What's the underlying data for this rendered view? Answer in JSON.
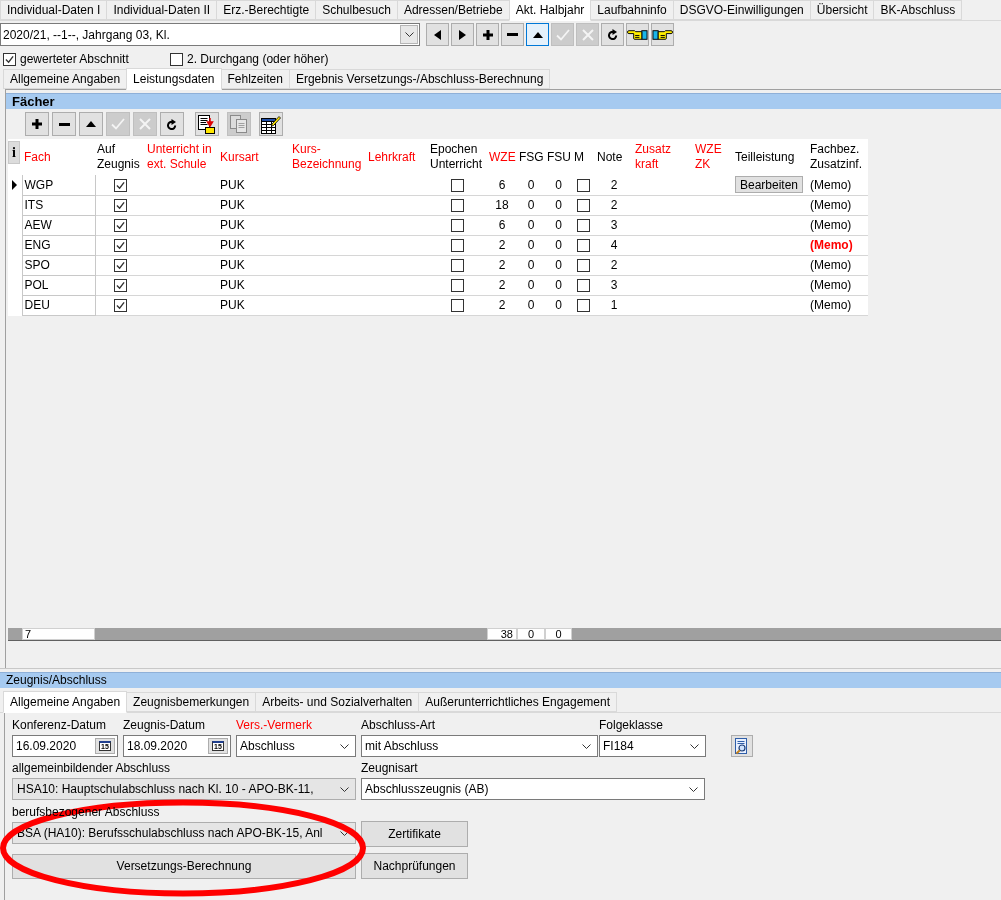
{
  "main_tabs": [
    {
      "label": "Individual-Daten I",
      "selected": false
    },
    {
      "label": "Individual-Daten II",
      "selected": false
    },
    {
      "label": "Erz.-Berechtigte",
      "selected": false
    },
    {
      "label": "Schulbesuch",
      "selected": false
    },
    {
      "label": "Adressen/Betriebe",
      "selected": false
    },
    {
      "label": "Akt. Halbjahr",
      "selected": true
    },
    {
      "label": "Laufbahninfo",
      "selected": false
    },
    {
      "label": "DSGVO-Einwilligungen",
      "selected": false
    },
    {
      "label": "Übersicht",
      "selected": false
    },
    {
      "label": "BK-Abschluss",
      "selected": false
    }
  ],
  "section_select": {
    "value": "2020/21, --1--, Jahrgang 03, Kl."
  },
  "nav_toolbar": [
    {
      "kind": "prev",
      "disabled": false,
      "focused": false
    },
    {
      "kind": "next",
      "disabled": false,
      "focused": false
    },
    {
      "kind": "add",
      "disabled": false,
      "focused": false
    },
    {
      "kind": "remove",
      "disabled": false,
      "focused": false
    },
    {
      "kind": "up",
      "disabled": false,
      "focused": true
    },
    {
      "kind": "confirm",
      "disabled": true,
      "focused": false
    },
    {
      "kind": "cancel",
      "disabled": true,
      "focused": false
    },
    {
      "kind": "refresh",
      "disabled": false,
      "focused": false
    },
    {
      "kind": "hand_left",
      "disabled": false,
      "focused": false
    },
    {
      "kind": "hand_right",
      "disabled": false,
      "focused": false
    }
  ],
  "options": [
    {
      "label": "gewerteter Abschnitt",
      "checked": true
    },
    {
      "label": "2. Durchgang (oder höher)",
      "checked": false
    }
  ],
  "sub_tabs": [
    {
      "label": "Allgemeine Angaben",
      "selected": false
    },
    {
      "label": "Leistungsdaten",
      "selected": true
    },
    {
      "label": "Fehlzeiten",
      "selected": false
    },
    {
      "label": "Ergebnis Versetzungs-/Abschluss-Berechnung",
      "selected": false
    }
  ],
  "faecher": {
    "title": "Fächer",
    "toolbar": [
      {
        "kind": "add",
        "disabled": false
      },
      {
        "kind": "remove",
        "disabled": false
      },
      {
        "kind": "up",
        "disabled": false
      },
      {
        "kind": "confirm",
        "disabled": true
      },
      {
        "kind": "cancel",
        "disabled": true
      },
      {
        "kind": "refresh",
        "disabled": false
      },
      {
        "kind": "import",
        "disabled": false
      },
      {
        "kind": "copy",
        "disabled": true
      },
      {
        "kind": "edit_table",
        "disabled": false
      }
    ],
    "info_button": "i",
    "columns": [
      {
        "label": "Fach",
        "color": "#ff0000"
      },
      {
        "label": "Auf Zeugnis",
        "color": "#000000"
      },
      {
        "label": "Unterricht in ext. Schule",
        "color": "#ff0000"
      },
      {
        "label": "Kursart",
        "color": "#ff0000"
      },
      {
        "label": "Kurs-Bezeichnung",
        "color": "#ff0000"
      },
      {
        "label": "Lehrkraft",
        "color": "#ff0000"
      },
      {
        "label": "Epochen Unterricht",
        "color": "#000000"
      },
      {
        "label": "WZE",
        "color": "#ff0000"
      },
      {
        "label": "FSG",
        "color": "#000000"
      },
      {
        "label": "FSU",
        "color": "#000000"
      },
      {
        "label": "M",
        "color": "#000000"
      },
      {
        "label": "Note",
        "color": "#000000"
      },
      {
        "label": "Zusatz kraft",
        "color": "#ff0000"
      },
      {
        "label": "WZE ZK",
        "color": "#ff0000"
      },
      {
        "label": "Teilleistung",
        "color": "#000000"
      },
      {
        "label": "Fachbez. Zusatzinf.",
        "color": "#000000"
      }
    ],
    "rows": [
      {
        "selected": true,
        "fach": "WGP",
        "auf_zeugnis": true,
        "kursart": "PUK",
        "epochen": false,
        "wze": "6",
        "fsg": "0",
        "fsu": "0",
        "m": false,
        "note": "2",
        "teilleistung": "Bearbeiten",
        "memo": "(Memo)",
        "memo_highlighted": false
      },
      {
        "selected": false,
        "fach": "ITS",
        "auf_zeugnis": true,
        "kursart": "PUK",
        "epochen": false,
        "wze": "18",
        "fsg": "0",
        "fsu": "0",
        "m": false,
        "note": "2",
        "memo": "(Memo)",
        "memo_highlighted": false
      },
      {
        "selected": false,
        "fach": "AEW",
        "auf_zeugnis": true,
        "kursart": "PUK",
        "epochen": false,
        "wze": "6",
        "fsg": "0",
        "fsu": "0",
        "m": false,
        "note": "3",
        "memo": "(Memo)",
        "memo_highlighted": false
      },
      {
        "selected": false,
        "fach": "ENG",
        "auf_zeugnis": true,
        "kursart": "PUK",
        "epochen": false,
        "wze": "2",
        "fsg": "0",
        "fsu": "0",
        "m": false,
        "note": "4",
        "memo": "(Memo)",
        "memo_highlighted": true
      },
      {
        "selected": false,
        "fach": "SPO",
        "auf_zeugnis": true,
        "kursart": "PUK",
        "epochen": false,
        "wze": "2",
        "fsg": "0",
        "fsu": "0",
        "m": false,
        "note": "2",
        "memo": "(Memo)",
        "memo_highlighted": false
      },
      {
        "selected": false,
        "fach": "POL",
        "auf_zeugnis": true,
        "kursart": "PUK",
        "epochen": false,
        "wze": "2",
        "fsg": "0",
        "fsu": "0",
        "m": false,
        "note": "3",
        "memo": "(Memo)",
        "memo_highlighted": false
      },
      {
        "selected": false,
        "fach": "DEU",
        "auf_zeugnis": true,
        "kursart": "PUK",
        "epochen": false,
        "wze": "2",
        "fsg": "0",
        "fsu": "0",
        "m": false,
        "note": "1",
        "memo": "(Memo)",
        "memo_highlighted": false
      }
    ],
    "totals": {
      "fach": "7",
      "wze": "38",
      "fsg": "0",
      "fsu": "0"
    }
  },
  "zeugnis_abschluss": {
    "title": "Zeugnis/Abschluss",
    "tabs": [
      {
        "label": "Allgemeine Angaben",
        "selected": true
      },
      {
        "label": "Zeugnisbemerkungen",
        "selected": false
      },
      {
        "label": "Arbeits- und Sozialverhalten",
        "selected": false
      },
      {
        "label": "Außerunterrichtliches Engagement",
        "selected": false
      }
    ],
    "fields": [
      {
        "label": "Konferenz-Datum",
        "value": "16.09.2020",
        "kind": "date",
        "calendar_label": "15",
        "highlighted": false
      },
      {
        "label": "Zeugnis-Datum",
        "value": "18.09.2020",
        "kind": "date",
        "calendar_label": "15",
        "highlighted": false
      },
      {
        "label": "Vers.-Vermerk",
        "value": "Abschluss",
        "kind": "combo",
        "highlighted": true
      },
      {
        "label": "Abschluss-Art",
        "value": "mit Abschluss",
        "kind": "combo",
        "highlighted": false
      },
      {
        "label": "Folgeklasse",
        "value": "FI184",
        "kind": "combo",
        "highlighted": false
      },
      {
        "label": "allgemeinbildender Abschluss",
        "value": "HSA10: Hauptschulabschluss nach Kl. 10 - APO-BK-11,",
        "kind": "list",
        "highlighted": false
      },
      {
        "label": "Zeugnisart",
        "value": "Abschlusszeugnis (AB)",
        "kind": "combo",
        "highlighted": false
      },
      {
        "label": "berufsbezogener Abschluss",
        "value": "BSA (HA10): Berufsschulabschluss nach APO-BK-15, Anl",
        "kind": "list",
        "highlighted": false
      }
    ],
    "buttons": [
      "Zertifikate",
      "Versetzungs-Berechnung",
      "Nachprüfungen"
    ]
  },
  "annotations": [
    {
      "kind": "ellipse"
    }
  ]
}
